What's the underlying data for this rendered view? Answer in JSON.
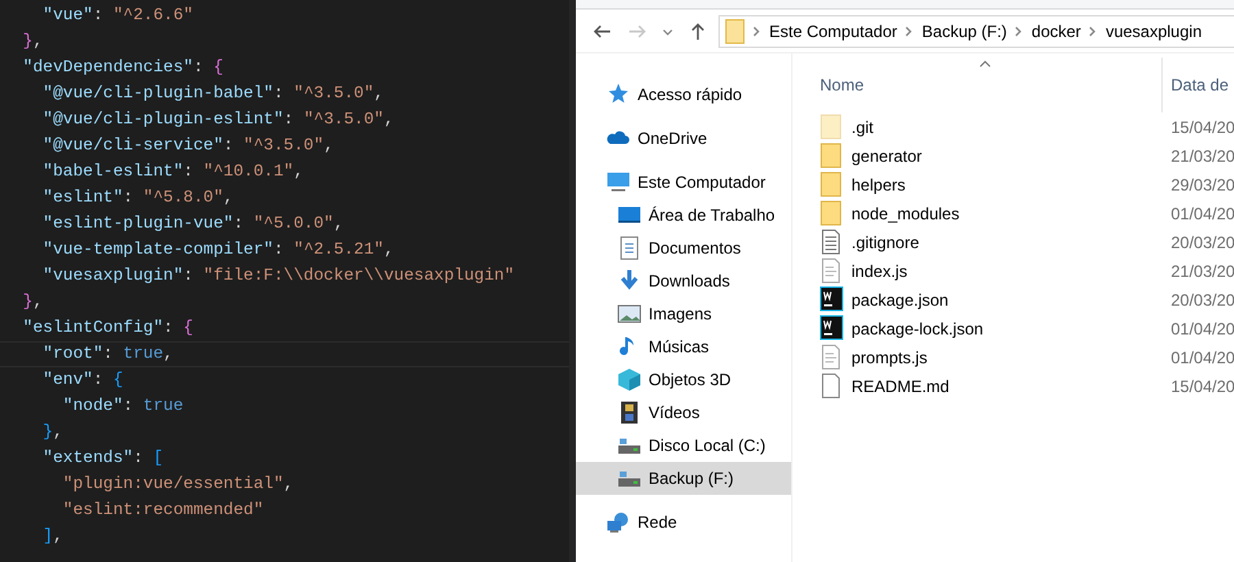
{
  "editor": {
    "lines": [
      {
        "current": false,
        "tokens": [
          {
            "kind": "key",
            "text": "    \"vue\""
          },
          {
            "kind": "punct",
            "text": ": "
          },
          {
            "kind": "string",
            "text": "\"^2.6.6\""
          }
        ]
      },
      {
        "current": false,
        "tokens": [
          {
            "kind": "bracket",
            "color": "#da70d6",
            "text": "  }"
          },
          {
            "kind": "punct",
            "text": ","
          }
        ]
      },
      {
        "current": false,
        "tokens": [
          {
            "kind": "key",
            "text": "  \"devDependencies\""
          },
          {
            "kind": "punct",
            "text": ": "
          },
          {
            "kind": "bracket",
            "color": "#da70d6",
            "text": "{"
          }
        ]
      },
      {
        "current": false,
        "tokens": [
          {
            "kind": "key",
            "text": "    \"@vue/cli-plugin-babel\""
          },
          {
            "kind": "punct",
            "text": ": "
          },
          {
            "kind": "string",
            "text": "\"^3.5.0\""
          },
          {
            "kind": "punct",
            "text": ","
          }
        ]
      },
      {
        "current": false,
        "tokens": [
          {
            "kind": "key",
            "text": "    \"@vue/cli-plugin-eslint\""
          },
          {
            "kind": "punct",
            "text": ": "
          },
          {
            "kind": "string",
            "text": "\"^3.5.0\""
          },
          {
            "kind": "punct",
            "text": ","
          }
        ]
      },
      {
        "current": false,
        "tokens": [
          {
            "kind": "key",
            "text": "    \"@vue/cli-service\""
          },
          {
            "kind": "punct",
            "text": ": "
          },
          {
            "kind": "string",
            "text": "\"^3.5.0\""
          },
          {
            "kind": "punct",
            "text": ","
          }
        ]
      },
      {
        "current": false,
        "tokens": [
          {
            "kind": "key",
            "text": "    \"babel-eslint\""
          },
          {
            "kind": "punct",
            "text": ": "
          },
          {
            "kind": "string",
            "text": "\"^10.0.1\""
          },
          {
            "kind": "punct",
            "text": ","
          }
        ]
      },
      {
        "current": false,
        "tokens": [
          {
            "kind": "key",
            "text": "    \"eslint\""
          },
          {
            "kind": "punct",
            "text": ": "
          },
          {
            "kind": "string",
            "text": "\"^5.8.0\""
          },
          {
            "kind": "punct",
            "text": ","
          }
        ]
      },
      {
        "current": false,
        "tokens": [
          {
            "kind": "key",
            "text": "    \"eslint-plugin-vue\""
          },
          {
            "kind": "punct",
            "text": ": "
          },
          {
            "kind": "string",
            "text": "\"^5.0.0\""
          },
          {
            "kind": "punct",
            "text": ","
          }
        ]
      },
      {
        "current": false,
        "tokens": [
          {
            "kind": "key",
            "text": "    \"vue-template-compiler\""
          },
          {
            "kind": "punct",
            "text": ": "
          },
          {
            "kind": "string",
            "text": "\"^2.5.21\""
          },
          {
            "kind": "punct",
            "text": ","
          }
        ]
      },
      {
        "current": false,
        "tokens": [
          {
            "kind": "key",
            "text": "    \"vuesaxplugin\""
          },
          {
            "kind": "punct",
            "text": ": "
          },
          {
            "kind": "string",
            "text": "\"file:F:\\\\docker\\\\vuesaxplugin\""
          }
        ]
      },
      {
        "current": false,
        "tokens": [
          {
            "kind": "bracket",
            "color": "#da70d6",
            "text": "  }"
          },
          {
            "kind": "punct",
            "text": ","
          }
        ]
      },
      {
        "current": false,
        "tokens": [
          {
            "kind": "key",
            "text": "  \"eslintConfig\""
          },
          {
            "kind": "punct",
            "text": ": "
          },
          {
            "kind": "bracket",
            "color": "#da70d6",
            "text": "{"
          }
        ]
      },
      {
        "current": true,
        "tokens": [
          {
            "kind": "key",
            "text": "    \"root\""
          },
          {
            "kind": "punct",
            "text": ": "
          },
          {
            "kind": "bool",
            "text": "true"
          },
          {
            "kind": "punct",
            "text": ","
          }
        ]
      },
      {
        "current": false,
        "tokens": [
          {
            "kind": "key",
            "text": "    \"env\""
          },
          {
            "kind": "punct",
            "text": ": "
          },
          {
            "kind": "bracket",
            "color": "#179fff",
            "text": "{"
          }
        ]
      },
      {
        "current": false,
        "tokens": [
          {
            "kind": "key",
            "text": "      \"node\""
          },
          {
            "kind": "punct",
            "text": ": "
          },
          {
            "kind": "bool",
            "text": "true"
          }
        ]
      },
      {
        "current": false,
        "tokens": [
          {
            "kind": "bracket",
            "color": "#179fff",
            "text": "    }"
          },
          {
            "kind": "punct",
            "text": ","
          }
        ]
      },
      {
        "current": false,
        "tokens": [
          {
            "kind": "key",
            "text": "    \"extends\""
          },
          {
            "kind": "punct",
            "text": ": "
          },
          {
            "kind": "bracket",
            "color": "#179fff",
            "text": "["
          }
        ]
      },
      {
        "current": false,
        "tokens": [
          {
            "kind": "string",
            "text": "      \"plugin:vue/essential\""
          },
          {
            "kind": "punct",
            "text": ","
          }
        ]
      },
      {
        "current": false,
        "tokens": [
          {
            "kind": "string",
            "text": "      \"eslint:recommended\""
          }
        ]
      },
      {
        "current": false,
        "tokens": [
          {
            "kind": "bracket",
            "color": "#179fff",
            "text": "    ]"
          },
          {
            "kind": "punct",
            "text": ","
          }
        ]
      }
    ]
  },
  "explorer": {
    "nav_buttons": [
      {
        "kind": "back",
        "disabled": false
      },
      {
        "kind": "forward",
        "disabled": true
      },
      {
        "kind": "recent",
        "disabled": false
      },
      {
        "kind": "up",
        "disabled": false
      }
    ],
    "breadcrumbs": [
      "Este Computador",
      "Backup (F:)",
      "docker",
      "vuesaxplugin"
    ],
    "sidebar": {
      "items": [
        {
          "label": "Acesso rápido",
          "kind": "star",
          "selected": false
        },
        {
          "label": "OneDrive",
          "kind": "cloud",
          "selected": false
        },
        {
          "label": "Este Computador",
          "kind": "monitor",
          "selected": false,
          "children": [
            {
              "label": "Área de Trabalho",
              "kind": "desktop",
              "selected": false
            },
            {
              "label": "Documentos",
              "kind": "document",
              "selected": false
            },
            {
              "label": "Downloads",
              "kind": "download",
              "selected": false
            },
            {
              "label": "Imagens",
              "kind": "image",
              "selected": false
            },
            {
              "label": "Músicas",
              "kind": "music",
              "selected": false
            },
            {
              "label": "Objetos 3D",
              "kind": "cube",
              "selected": false
            },
            {
              "label": "Vídeos",
              "kind": "film",
              "selected": false
            },
            {
              "label": "Disco Local (C:)",
              "kind": "drive",
              "selected": false
            },
            {
              "label": "Backup (F:)",
              "kind": "drive",
              "selected": true
            }
          ]
        },
        {
          "label": "Rede",
          "kind": "network",
          "selected": false
        }
      ]
    },
    "columns": [
      "Nome",
      "Data de"
    ],
    "files": [
      {
        "name": ".git",
        "date": "15/04/20",
        "kind": "folder",
        "hidden": true
      },
      {
        "name": "generator",
        "date": "21/03/20",
        "kind": "folder",
        "hidden": false
      },
      {
        "name": "helpers",
        "date": "29/03/20",
        "kind": "folder",
        "hidden": false
      },
      {
        "name": "node_modules",
        "date": "01/04/20",
        "kind": "folder",
        "hidden": false
      },
      {
        "name": ".gitignore",
        "date": "20/03/20",
        "kind": "text",
        "hidden": false
      },
      {
        "name": "index.js",
        "date": "21/03/20",
        "kind": "script",
        "hidden": false
      },
      {
        "name": "package.json",
        "date": "20/03/20",
        "kind": "webstorm",
        "hidden": false
      },
      {
        "name": "package-lock.json",
        "date": "01/04/20",
        "kind": "webstorm",
        "hidden": false
      },
      {
        "name": "prompts.js",
        "date": "01/04/20",
        "kind": "script",
        "hidden": false
      },
      {
        "name": "README.md",
        "date": "15/04/20",
        "kind": "blank",
        "hidden": false
      }
    ]
  }
}
